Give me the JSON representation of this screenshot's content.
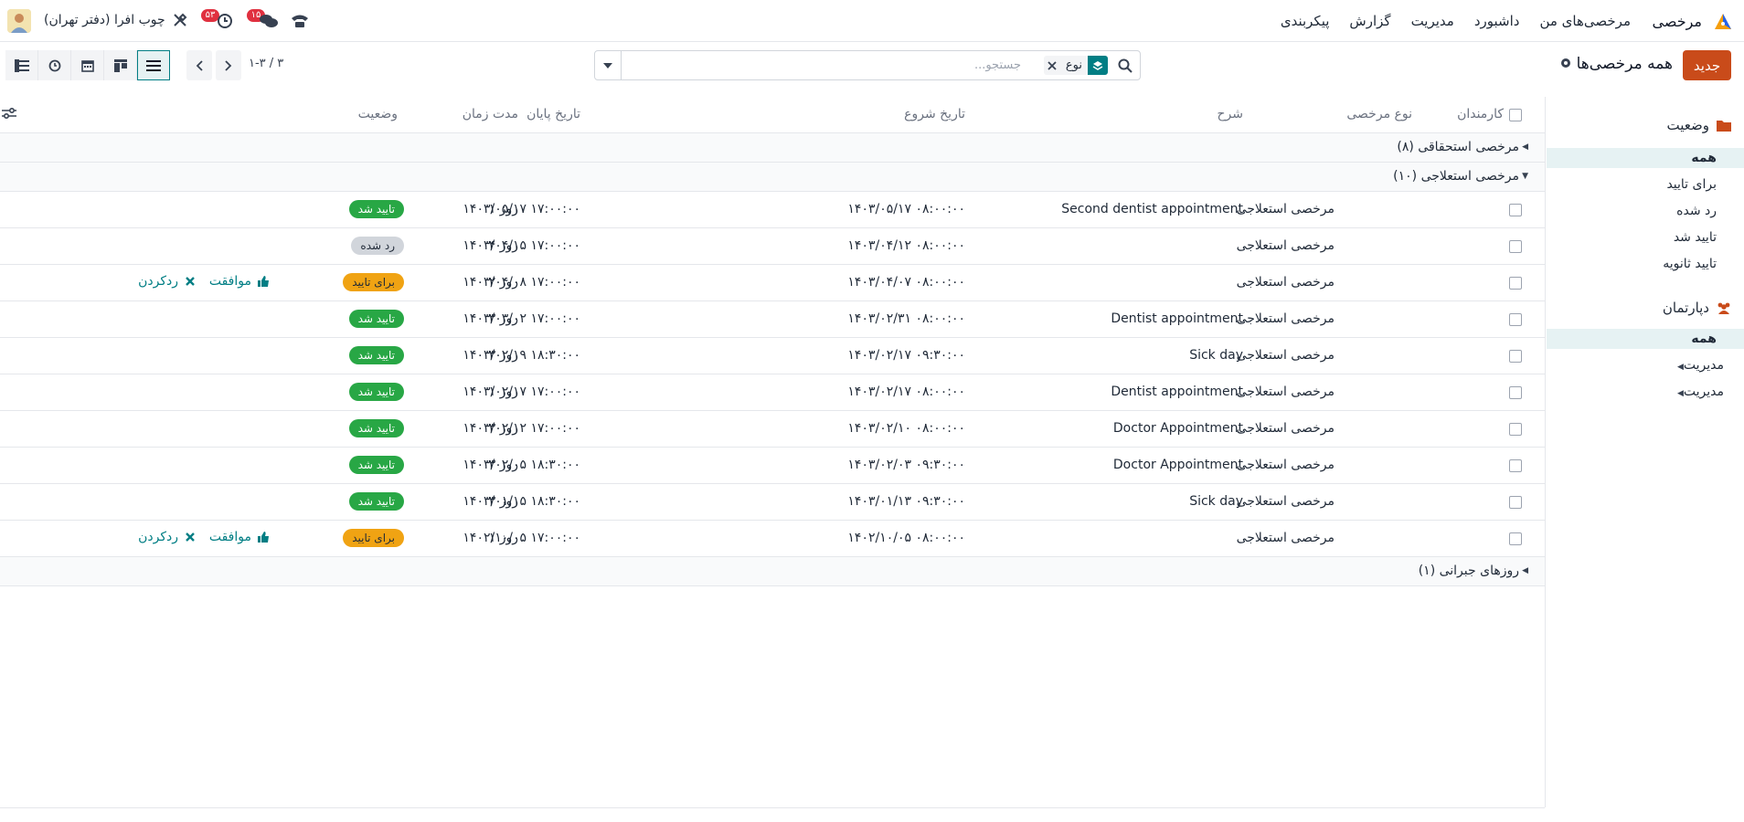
{
  "navbar": {
    "app_name": "مرخصی",
    "menu": [
      "مرخصی‌های من",
      "داشبورد",
      "مدیریت",
      "گزارش",
      "پیکربندی"
    ],
    "company": "چوب افرا (دفتر تهران)",
    "activity_count": "۵۳",
    "message_count": "۱۵"
  },
  "control": {
    "new_label": "جدید",
    "title": "همه مرخصی‌ها",
    "facet_label": "نوع",
    "search_placeholder": "جستجو...",
    "pager": "۱-۳ / ۳"
  },
  "sidebar": {
    "status_title": "وضعیت",
    "status_items": [
      "همه",
      "برای تایید",
      "رد شده",
      "تایید شد",
      "تایید ثانویه"
    ],
    "dept_title": "دپارتمان",
    "dept_items": [
      "همه",
      "مدیریت",
      "مدیریت"
    ]
  },
  "columns": {
    "employees": "کارمندان",
    "leave_type": "نوع مرخصی",
    "description": "شرح",
    "start": "تاریخ شروع",
    "end": "تاریخ پایان",
    "duration": "مدت زمان",
    "status": "وضعیت"
  },
  "groups": [
    {
      "label": "مرخصی استحقاقی (۸)"
    },
    {
      "label": "مرخصی استعلاجی (۱۰)"
    },
    {
      "label": "روزهای جبرانی (۱)"
    }
  ],
  "rows": [
    {
      "type": "مرخصی استعلاجی",
      "desc": "Second dentist appointment",
      "start": "۱۴۰۳/۰۵/۱۷ ۰۸:۰۰:۰۰",
      "end": "۱۴۰۳/۰۵/۱۷ ۱۷:۰۰:۰۰",
      "duration": "۱ روز",
      "status": "تایید شد",
      "kind": "ok"
    },
    {
      "type": "مرخصی استعلاجی",
      "desc": "",
      "start": "۱۴۰۳/۰۴/۱۲ ۰۸:۰۰:۰۰",
      "end": "۱۴۰۳/۰۴/۱۵ ۱۷:۰۰:۰۰",
      "duration": "۴ روز",
      "status": "رد شده",
      "kind": "ref"
    },
    {
      "type": "مرخصی استعلاجی",
      "desc": "",
      "start": "۱۴۰۳/۰۴/۰۷ ۰۸:۰۰:۰۰",
      "end": "۱۴۰۳/۰۴/۰۸ ۱۷:۰۰:۰۰",
      "duration": "۲ روز",
      "status": "برای تایید",
      "kind": "wait",
      "approve": "موافقت",
      "refuse": "ردکردن"
    },
    {
      "type": "مرخصی استعلاجی",
      "desc": "Dentist appointment",
      "start": "۱۴۰۳/۰۲/۳۱ ۰۸:۰۰:۰۰",
      "end": "۱۴۰۳/۰۳/۰۲ ۱۷:۰۰:۰۰",
      "duration": "۳ روز",
      "status": "تایید شد",
      "kind": "ok"
    },
    {
      "type": "مرخصی استعلاجی",
      "desc": "Sick day",
      "start": "۱۴۰۳/۰۲/۱۷ ۰۹:۳۰:۰۰",
      "end": "۱۴۰۳/۰۲/۱۹ ۱۸:۳۰:۰۰",
      "duration": "۳ روز",
      "status": "تایید شد",
      "kind": "ok"
    },
    {
      "type": "مرخصی استعلاجی",
      "desc": "Dentist appointment",
      "start": "۱۴۰۳/۰۲/۱۷ ۰۸:۰۰:۰۰",
      "end": "۱۴۰۳/۰۲/۱۷ ۱۷:۰۰:۰۰",
      "duration": "۱ روز",
      "status": "تایید شد",
      "kind": "ok"
    },
    {
      "type": "مرخصی استعلاجی",
      "desc": "Doctor Appointment",
      "start": "۱۴۰۳/۰۲/۱۰ ۰۸:۰۰:۰۰",
      "end": "۱۴۰۳/۰۲/۱۲ ۱۷:۰۰:۰۰",
      "duration": "۳ روز",
      "status": "تایید شد",
      "kind": "ok"
    },
    {
      "type": "مرخصی استعلاجی",
      "desc": "Doctor Appointment",
      "start": "۱۴۰۳/۰۲/۰۳ ۰۹:۳۰:۰۰",
      "end": "۱۴۰۳/۰۲/۰۵ ۱۸:۳۰:۰۰",
      "duration": "۳ روز",
      "status": "تایید شد",
      "kind": "ok"
    },
    {
      "type": "مرخصی استعلاجی",
      "desc": "Sick day",
      "start": "۱۴۰۳/۰۱/۱۳ ۰۹:۳۰:۰۰",
      "end": "۱۴۰۳/۰۱/۱۵ ۱۸:۳۰:۰۰",
      "duration": "۳ روز",
      "status": "تایید شد",
      "kind": "ok"
    },
    {
      "type": "مرخصی استعلاجی",
      "desc": "",
      "start": "۱۴۰۲/۱۰/۰۵ ۰۸:۰۰:۰۰",
      "end": "۱۴۰۲/۱۰/۰۵ ۱۷:۰۰:۰۰",
      "duration": "۱ روز",
      "status": "برای تایید",
      "kind": "wait",
      "approve": "موافقت",
      "refuse": "ردکردن"
    }
  ],
  "colors": {
    "brand": "#c94b1a",
    "teal": "#017e84",
    "approved": "#28a745",
    "pending": "#f0a313",
    "refused": "#d1d5db"
  }
}
